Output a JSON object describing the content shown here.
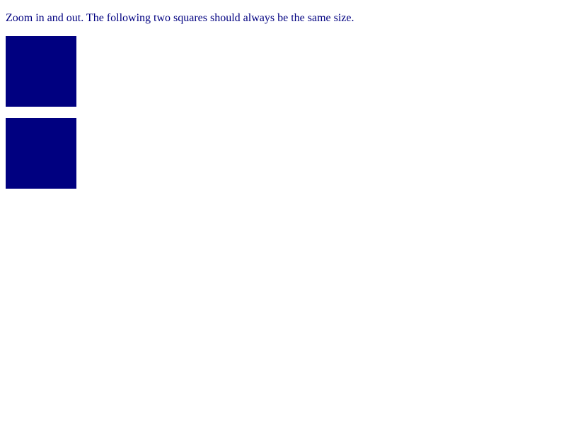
{
  "instruction_text": "Zoom in and out. The following two squares should always be the same size.",
  "colors": {
    "text": "#000080",
    "square_fill": "#000080",
    "background": "#ffffff"
  }
}
